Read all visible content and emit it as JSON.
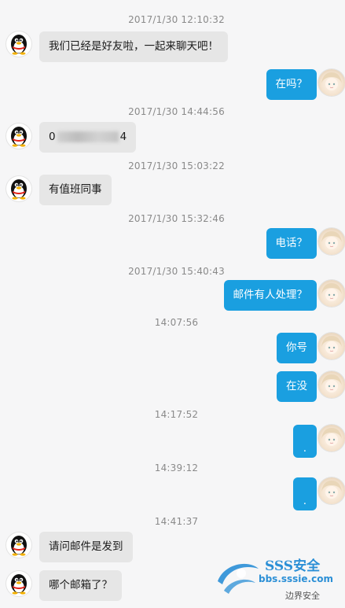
{
  "messages": [
    {
      "kind": "timestamp",
      "text": "2017/1/30 12:10:32"
    },
    {
      "kind": "left",
      "text": "我们已经是好友啦，一起来聊天吧！"
    },
    {
      "kind": "right",
      "text": "在吗？"
    },
    {
      "kind": "timestamp",
      "text": "2017/1/30 14:44:56"
    },
    {
      "kind": "left-redacted",
      "prefix": "0",
      "suffix": "4"
    },
    {
      "kind": "timestamp",
      "text": "2017/1/30 15:03:22"
    },
    {
      "kind": "left",
      "text": "有值班同事"
    },
    {
      "kind": "timestamp",
      "text": "2017/1/30 15:32:46"
    },
    {
      "kind": "right",
      "text": "电话？"
    },
    {
      "kind": "timestamp",
      "text": "2017/1/30 15:40:43"
    },
    {
      "kind": "right",
      "text": "邮件有人处理？"
    },
    {
      "kind": "timestamp",
      "text": "14:07:56"
    },
    {
      "kind": "right",
      "text": "你号"
    },
    {
      "kind": "right",
      "text": "在没"
    },
    {
      "kind": "timestamp",
      "text": "14:17:52"
    },
    {
      "kind": "right",
      "text": "."
    },
    {
      "kind": "timestamp",
      "text": "14:39:12"
    },
    {
      "kind": "right",
      "text": "."
    },
    {
      "kind": "timestamp",
      "text": "14:41:37"
    },
    {
      "kind": "left",
      "text": "请问邮件是发到"
    },
    {
      "kind": "left",
      "text": "哪个邮箱了？"
    }
  ],
  "watermark": {
    "title": "SSS安全",
    "url": "bbs.sssie.com",
    "badge": "边界安全"
  },
  "colors": {
    "left_bubble": "#e6e6e6",
    "right_bubble": "#1a9fe0",
    "background": "#f6f6f7"
  },
  "icons": {
    "left_avatar": "qq-penguin-icon",
    "right_avatar": "anime-avatar-icon"
  }
}
